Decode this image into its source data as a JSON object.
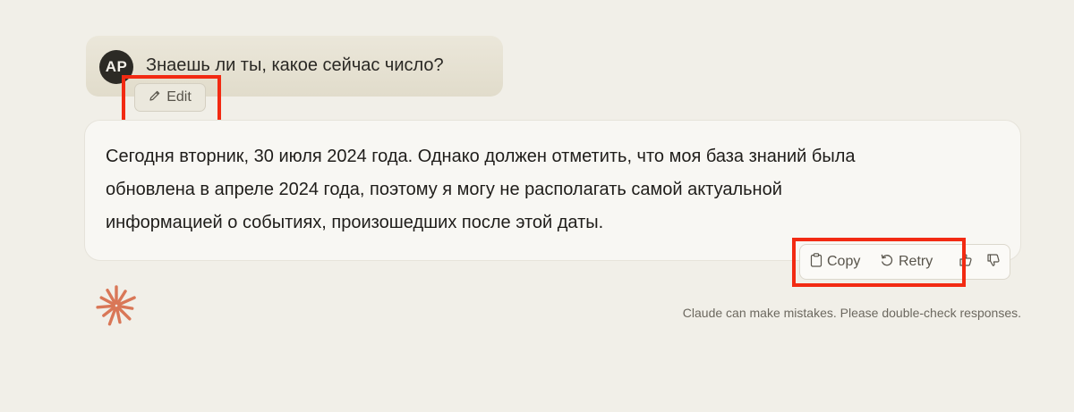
{
  "user_message": {
    "avatar_initials": "AP",
    "text": "Знаешь ли ты, какое сейчас число?",
    "edit_label": "Edit",
    "edit_icon": "pencil-icon"
  },
  "assistant_message": {
    "lines": [
      "Сегодня вторник, 30 июля 2024 года. Однако должен отметить, что моя база знаний была",
      "обновлена в апреле 2024 года, поэтому я могу не располагать самой актуальной",
      "информацией о событиях, произошедших после этой даты."
    ],
    "actions": {
      "copy_label": "Copy",
      "copy_icon": "clipboard-icon",
      "retry_label": "Retry",
      "retry_icon": "retry-icon",
      "thumbs_up_icon": "thumbs-up-icon",
      "thumbs_down_icon": "thumbs-down-icon"
    }
  },
  "footer": {
    "logo_icon": "claude-spark-icon",
    "disclaimer": "Claude can make mistakes. Please double-check responses."
  },
  "colors": {
    "background": "#f1efe8",
    "highlight": "#f22a12",
    "logo": "#d97757",
    "avatar": "#2c2a25"
  }
}
